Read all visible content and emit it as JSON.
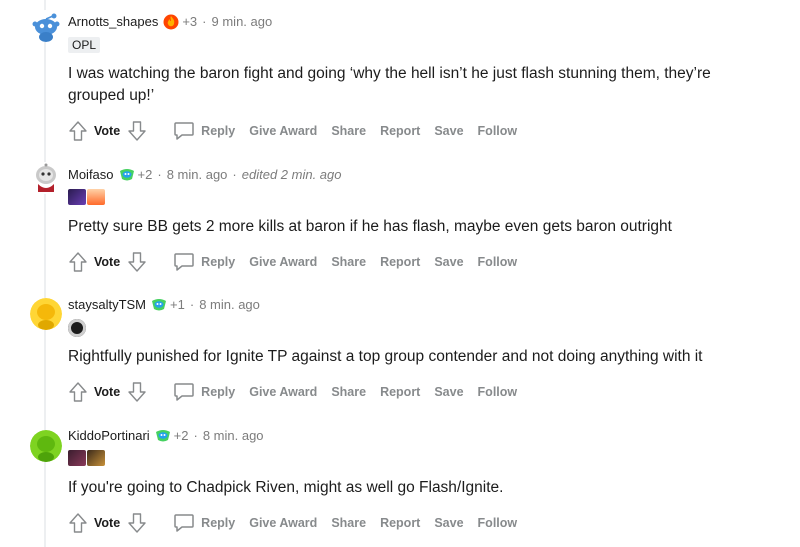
{
  "comments": [
    {
      "author": "Arnotts_shapes",
      "award_count": "+3",
      "time": "9 min. ago",
      "edited": "",
      "flair_text": "OPL",
      "body": "I was watching the baron fight and going ‘why the hell isn’t he just flash stunning them, they’re grouped up!’",
      "avatar_icon": "snoo-avatar-icon",
      "award_icon": "fire-award-icon"
    },
    {
      "author": "Moifaso",
      "award_count": "+2",
      "time": "8 min. ago",
      "edited": "edited 2 min. ago",
      "body": "Pretty sure BB gets 2 more kills at baron if he has flash, maybe even gets baron outright",
      "avatar_icon": "robot-avatar-icon",
      "award_icon": "helpful-award-icon"
    },
    {
      "author": "staysaltyTSM",
      "award_count": "+1",
      "time": "8 min. ago",
      "edited": "",
      "body": "Rightfully punished for Ignite TP against a top group contender and not doing anything with it",
      "avatar_icon": "yellow-avatar-icon",
      "award_icon": "helpful-award-icon"
    },
    {
      "author": "KiddoPortinari",
      "award_count": "+2",
      "time": "8 min. ago",
      "edited": "",
      "body": "If you're going to Chadpick Riven, might as well go Flash/Ignite.",
      "avatar_icon": "green-avatar-icon",
      "award_icon": "helpful-award-icon"
    }
  ],
  "actions": {
    "vote": "Vote",
    "reply": "Reply",
    "give_award": "Give Award",
    "share": "Share",
    "report": "Report",
    "save": "Save",
    "follow": "Follow"
  },
  "dot": "·",
  "colors": {
    "meta_gray": "#7c7c7c",
    "action_gray": "#878a8c",
    "text": "#1c1c1c",
    "flair_bg": "#edeff1",
    "thread_line": "#edeff1"
  }
}
